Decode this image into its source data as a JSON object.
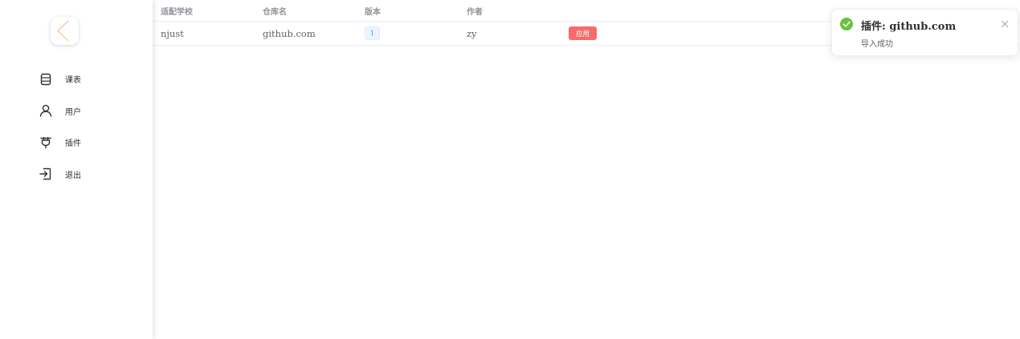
{
  "sidebar": {
    "logo": {
      "icon": "chevron-left-gradient-logo",
      "colors": [
        "#f7a4a4",
        "#f6d28a"
      ]
    },
    "items": [
      {
        "icon": "database-icon",
        "label": "课表"
      },
      {
        "icon": "user-icon",
        "label": "用户"
      },
      {
        "icon": "plug-icon",
        "label": "插件"
      },
      {
        "icon": "logout-icon",
        "label": "退出"
      }
    ]
  },
  "table": {
    "headers": [
      "适配学校",
      "仓库名",
      "版本",
      "作者",
      ""
    ],
    "rows": [
      {
        "school": "njust",
        "repo": "github.com",
        "version": "1",
        "author": "zy",
        "action": "应用"
      }
    ]
  },
  "notification": {
    "type": "success",
    "icon": "check-circle-icon",
    "title": "插件: github.com",
    "message": "导入成功",
    "close_icon": "close-icon"
  },
  "colors": {
    "success": "#67c23a",
    "danger": "#f56c6c",
    "primary": "#409eff",
    "header_text": "#909399",
    "body_text": "#606266"
  }
}
